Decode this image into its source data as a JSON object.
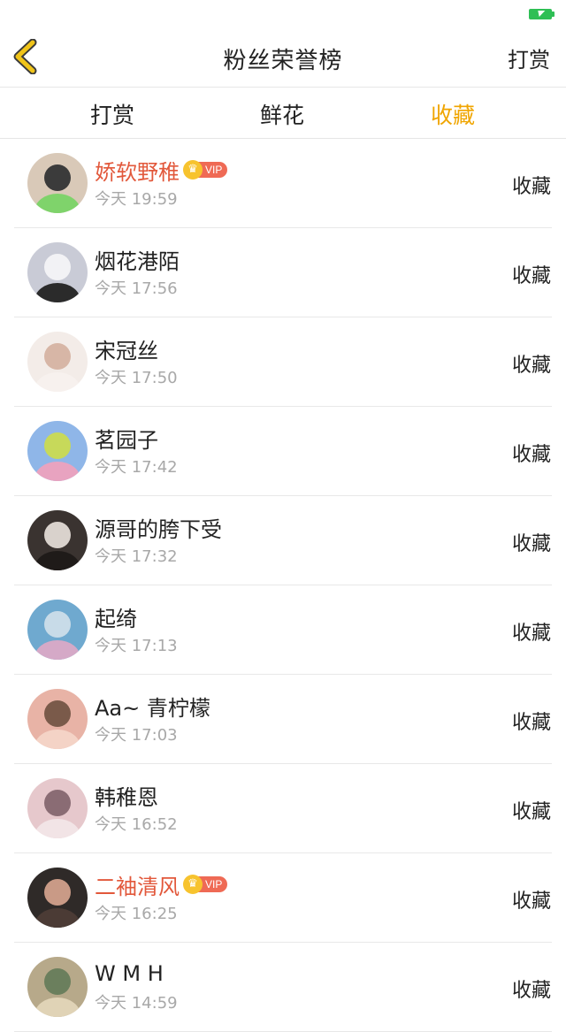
{
  "header": {
    "title": "粉丝荣誉榜",
    "right_link": "打赏",
    "back_icon": "chevron-left-icon",
    "back_icon_color": "#f0c419"
  },
  "status_bar": {
    "battery_icon": "battery-charging-icon",
    "battery_color": "#2fbf55"
  },
  "tabs": [
    {
      "label": "打赏",
      "active": false
    },
    {
      "label": "鲜花",
      "active": false
    },
    {
      "label": "收藏",
      "active": true
    }
  ],
  "accent_color": "#f0a500",
  "vip_name_color": "#e2583b",
  "vip_badge_text": "VIP",
  "fans": [
    {
      "name": "娇软野稚",
      "time": "今天 19:59",
      "action": "收藏",
      "vip": true
    },
    {
      "name": "烟花港陌",
      "time": "今天 17:56",
      "action": "收藏",
      "vip": false
    },
    {
      "name": "宋冠丝",
      "time": "今天 17:50",
      "action": "收藏",
      "vip": false
    },
    {
      "name": "茗园子",
      "time": "今天 17:42",
      "action": "收藏",
      "vip": false
    },
    {
      "name": "源哥的胯下受",
      "time": "今天 17:32",
      "action": "收藏",
      "vip": false
    },
    {
      "name": "起绮",
      "time": "今天 17:13",
      "action": "收藏",
      "vip": false
    },
    {
      "name": "Aa~ 青柠檬",
      "time": "今天 17:03",
      "action": "收藏",
      "vip": false
    },
    {
      "name": "韩稚恩",
      "time": "今天 16:52",
      "action": "收藏",
      "vip": false
    },
    {
      "name": "二袖清风",
      "time": "今天 16:25",
      "action": "收藏",
      "vip": true
    },
    {
      "name": "W M H",
      "time": "今天 14:59",
      "action": "收藏",
      "vip": false
    }
  ]
}
